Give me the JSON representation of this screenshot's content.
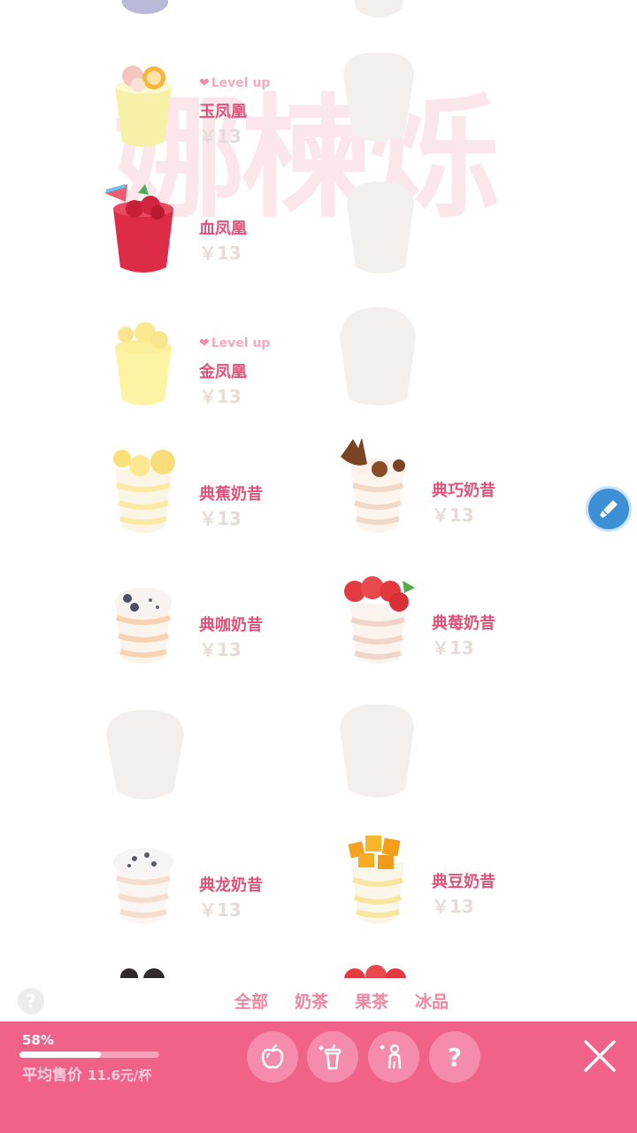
{
  "watermark": "娜楝烁",
  "level_up_label": "Level up",
  "items": [
    {
      "name": "玉凤凰",
      "price": "￥13",
      "level_up": true
    },
    {
      "name": "血凤凰",
      "price": "￥13",
      "level_up": false
    },
    {
      "name": "金凤凰",
      "price": "￥13",
      "level_up": true
    },
    {
      "name": "典蕉奶昔",
      "price": "￥13"
    },
    {
      "name": "典巧奶昔",
      "price": "￥13"
    },
    {
      "name": "典咖奶昔",
      "price": "￥13"
    },
    {
      "name": "典莓奶昔",
      "price": "￥13"
    },
    {
      "name": "典龙奶昔",
      "price": "￥13"
    },
    {
      "name": "典豆奶昔",
      "price": "￥13"
    }
  ],
  "help_icon": "?",
  "tabs": [
    "全部",
    "奶茶",
    "果茶",
    "冰品"
  ],
  "footer": {
    "progress_label": "58%",
    "progress_value": 0.58,
    "avg_label": "平均售价",
    "avg_value": "11.6元/杯",
    "buttons": [
      "apple-icon",
      "cup-icon",
      "person-icon",
      "question-icon"
    ],
    "question_text": "?"
  },
  "colors": {
    "accent": "#f06288",
    "name": "#e0527a",
    "fab": "#3d8fd6"
  }
}
